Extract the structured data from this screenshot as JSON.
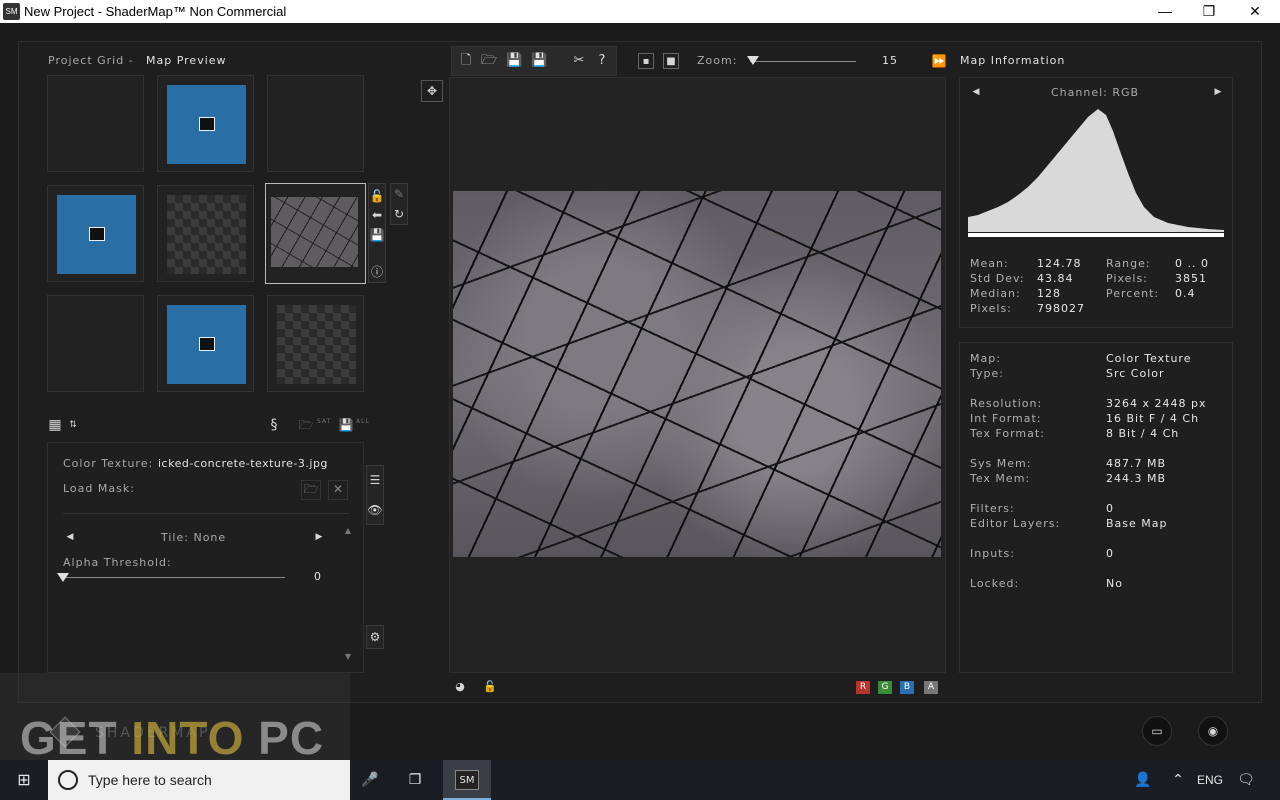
{
  "window": {
    "title": "New Project - ShaderMap™ Non Commercial",
    "logo": "SM",
    "minimize": "—",
    "maximize": "❐",
    "close": "✕"
  },
  "grid": {
    "title_prefix": "Project Grid  -",
    "title": "Map Preview"
  },
  "zoom": {
    "label": "Zoom:",
    "value": "15",
    "fraction": 0.0
  },
  "map_info_title": "Map Information",
  "properties": {
    "color_texture_label": "Color Texture:",
    "color_texture_value": "icked-concrete-texture-3.jpg",
    "load_mask_label": "Load Mask:",
    "tile_label": "Tile: None",
    "alpha_label": "Alpha Threshold:",
    "alpha_value": 0,
    "all_label": "ALL",
    "sat_label": "SAT"
  },
  "histogram": {
    "channel_label": "Channel: RGB",
    "stats": [
      {
        "k": "Mean:",
        "v": "124.78"
      },
      {
        "k": "Std Dev:",
        "v": "43.84"
      },
      {
        "k": "Median:",
        "v": "128"
      },
      {
        "k": "Pixels:",
        "v": "798027"
      }
    ],
    "stats2": [
      {
        "k": "Range:",
        "v": "0 .. 0"
      },
      {
        "k": "Pixels:",
        "v": "3851"
      },
      {
        "k": "Percent:",
        "v": "0.4"
      }
    ]
  },
  "map_info": {
    "map_k": "Map:",
    "map_v": "Color Texture",
    "type_k": "Type:",
    "type_v": "Src Color",
    "res_k": "Resolution:",
    "res_v": "3264 x 2448 px",
    "int_k": "Int Format:",
    "int_v": "16 Bit F / 4 Ch",
    "tex_k": "Tex Format:",
    "tex_v": "8 Bit / 4 Ch",
    "sys_k": "Sys Mem:",
    "sys_v": "487.7 MB",
    "texm_k": "Tex Mem:",
    "texm_v": "244.3 MB",
    "filt_k": "Filters:",
    "filt_v": "0",
    "edit_k": "Editor Layers:",
    "edit_v": "Base Map",
    "inp_k": "Inputs:",
    "inp_v": "0",
    "lock_k": "Locked:",
    "lock_v": "No"
  },
  "channels": {
    "r": "R",
    "g": "G",
    "b": "B",
    "a": "A"
  },
  "watermark": {
    "part1": "GET ",
    "part2": "INTO",
    "part3": " PC",
    "sub": "SHADERMAP"
  },
  "taskbar": {
    "search_placeholder": "Type here to search",
    "lang": "ENG",
    "app_label": "SM"
  },
  "colors": {
    "accent_blue": "#2a6ea6",
    "red": "#b8342b",
    "green": "#3a8a3a",
    "blue": "#2a6fb0",
    "alpha": "#777777"
  }
}
